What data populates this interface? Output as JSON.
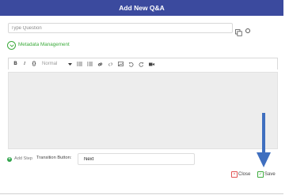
{
  "dialog": {
    "title": "Add New Q&A"
  },
  "question": {
    "placeholder": "Type Question"
  },
  "metadata": {
    "label": "Metadata Management"
  },
  "toolbar": {
    "bold": "B",
    "italic": "I",
    "code": "{}",
    "format_select": "Normal",
    "icons": [
      "bullet-list-icon",
      "numbered-list-icon",
      "link-icon",
      "unlink-icon",
      "image-icon",
      "undo-icon",
      "redo-icon",
      "video-icon"
    ]
  },
  "footer": {
    "add_step": "Add Step",
    "transition_label": "Transition Button:",
    "transition_value": "Next",
    "close_label": "Close",
    "save_label": "Save"
  },
  "colors": {
    "header": "#3b4a9e",
    "accent_green": "#3cab3c",
    "close_red": "#e05252",
    "arrow_blue": "#3f6fbf"
  }
}
